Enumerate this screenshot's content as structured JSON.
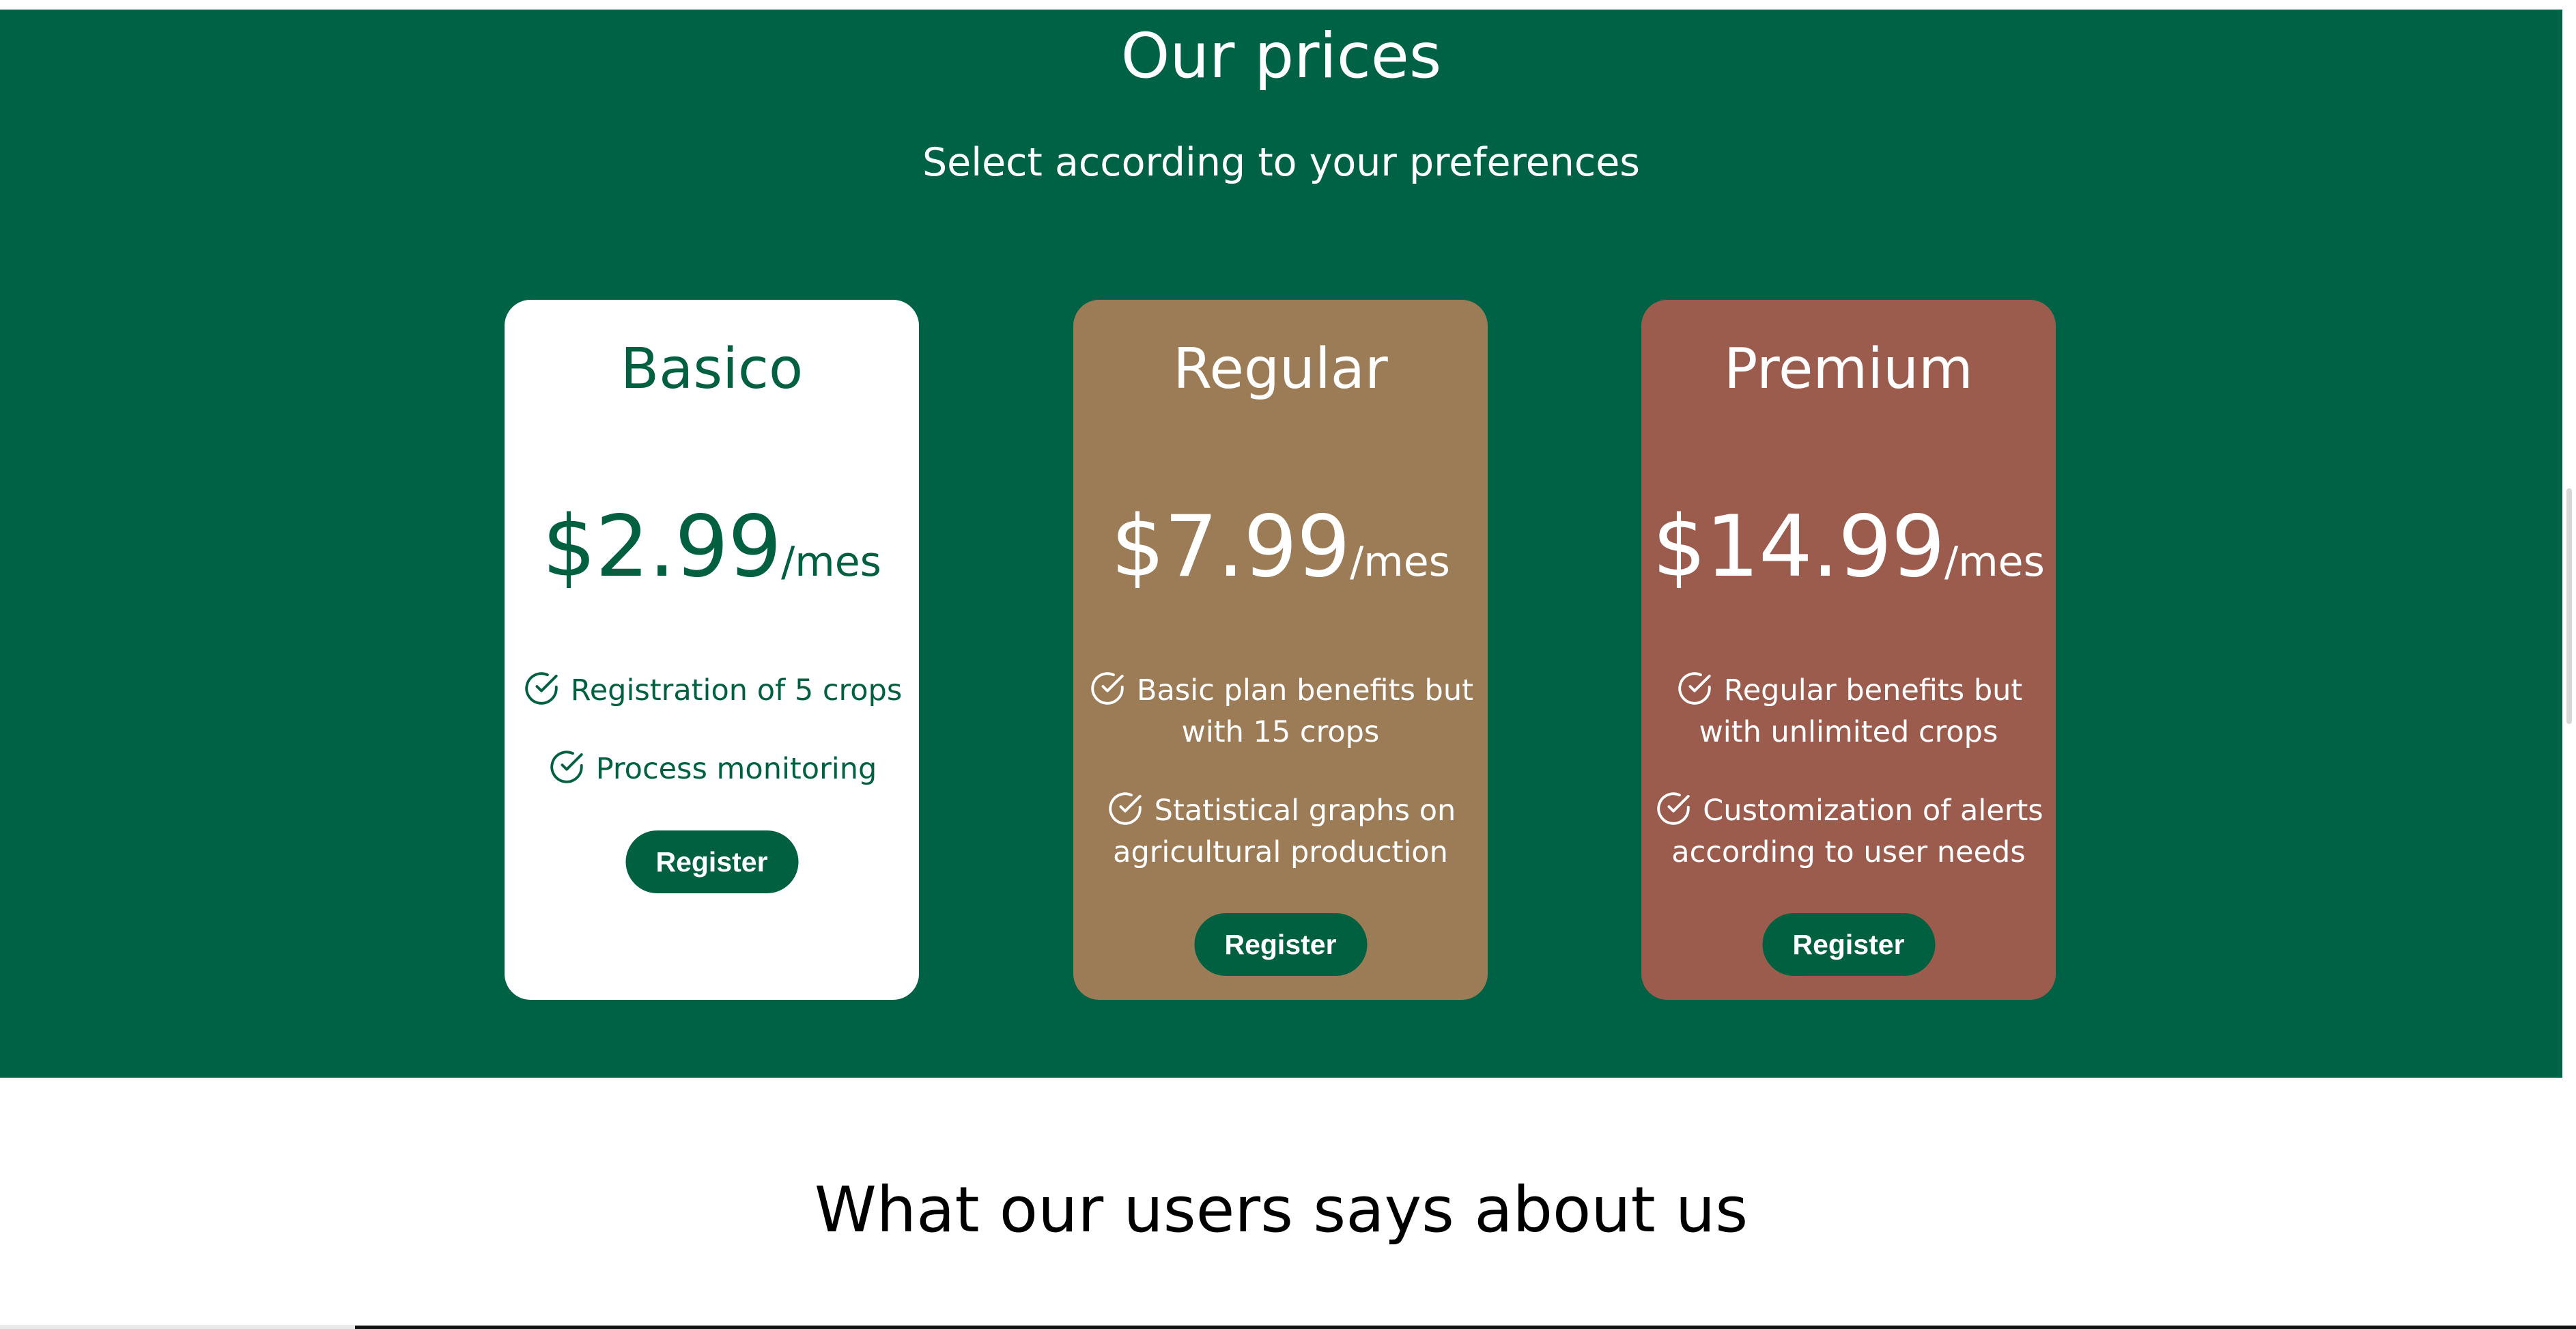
{
  "prices": {
    "title": "Our prices",
    "subtitle": "Select according to your preferences"
  },
  "colors": {
    "section_bg": "#006244",
    "basic_card": "#ffffff",
    "regular_card": "#9c7b57",
    "premium_card": "#9b5c4e",
    "button_bg": "#00603f"
  },
  "plans": [
    {
      "name": "Basico",
      "price": "$2.99",
      "period": "/mes",
      "features": [
        "Registration of 5 crops",
        "Process monitoring"
      ],
      "button_label": "Register"
    },
    {
      "name": "Regular",
      "price": "$7.99",
      "period": "/mes",
      "features": [
        "Basic plan benefits but with 15 crops",
        "Statistical graphs on agricultural production"
      ],
      "button_label": "Register"
    },
    {
      "name": "Premium",
      "price": "$14.99",
      "period": "/mes",
      "features": [
        "Regular benefits but with unlimited crops",
        "Customization of alerts according to user needs"
      ],
      "button_label": "Register"
    }
  ],
  "testimonials": {
    "title": "What our users says about us"
  }
}
